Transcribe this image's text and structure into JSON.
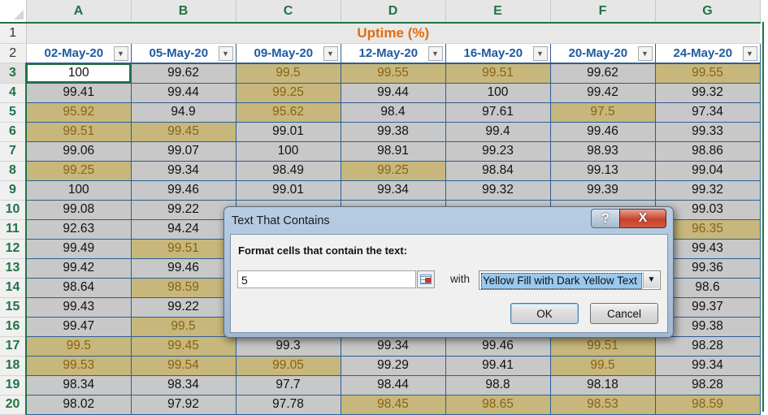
{
  "sheet": {
    "columns": [
      "A",
      "B",
      "C",
      "D",
      "E",
      "F",
      "G"
    ],
    "title_row": {
      "row": "1",
      "text": "Uptime (%)"
    },
    "header_row": {
      "row": "2",
      "dates": [
        "02-May-20",
        "05-May-20",
        "09-May-20",
        "12-May-20",
        "16-May-20",
        "20-May-20",
        "24-May-20"
      ],
      "filter_icon": "dropdown-arrow"
    },
    "rows": [
      {
        "num": "3",
        "values": [
          "100",
          "99.62",
          "99.5",
          "99.55",
          "99.51",
          "99.62",
          "99.55"
        ],
        "highlight": [
          false,
          false,
          true,
          true,
          true,
          false,
          true
        ]
      },
      {
        "num": "4",
        "values": [
          "99.41",
          "99.44",
          "99.25",
          "99.44",
          "100",
          "99.42",
          "99.32"
        ],
        "highlight": [
          false,
          false,
          true,
          false,
          false,
          false,
          false
        ]
      },
      {
        "num": "5",
        "values": [
          "95.92",
          "94.9",
          "95.62",
          "98.4",
          "97.61",
          "97.5",
          "97.34"
        ],
        "highlight": [
          true,
          false,
          true,
          false,
          false,
          true,
          false
        ]
      },
      {
        "num": "6",
        "values": [
          "99.51",
          "99.45",
          "99.01",
          "99.38",
          "99.4",
          "99.46",
          "99.33"
        ],
        "highlight": [
          true,
          true,
          false,
          false,
          false,
          false,
          false
        ]
      },
      {
        "num": "7",
        "values": [
          "99.06",
          "99.07",
          "100",
          "98.91",
          "99.23",
          "98.93",
          "98.86"
        ],
        "highlight": [
          false,
          false,
          false,
          false,
          false,
          false,
          false
        ]
      },
      {
        "num": "8",
        "values": [
          "99.25",
          "99.34",
          "98.49",
          "99.25",
          "98.84",
          "99.13",
          "99.04"
        ],
        "highlight": [
          true,
          false,
          false,
          true,
          false,
          false,
          false
        ]
      },
      {
        "num": "9",
        "values": [
          "100",
          "99.46",
          "99.01",
          "99.34",
          "99.32",
          "99.39",
          "99.32"
        ],
        "highlight": [
          false,
          false,
          false,
          false,
          false,
          false,
          false
        ]
      },
      {
        "num": "10",
        "values": [
          "99.08",
          "99.22",
          "",
          "",
          "",
          "",
          "99.03"
        ],
        "highlight": [
          false,
          false,
          false,
          false,
          false,
          false,
          false
        ]
      },
      {
        "num": "11",
        "values": [
          "92.63",
          "94.24",
          "",
          "",
          "",
          "",
          "96.35"
        ],
        "highlight": [
          false,
          false,
          false,
          true,
          false,
          false,
          true
        ]
      },
      {
        "num": "12",
        "values": [
          "99.49",
          "99.51",
          "",
          "",
          "",
          "",
          "99.43"
        ],
        "highlight": [
          false,
          true,
          false,
          false,
          false,
          false,
          false
        ]
      },
      {
        "num": "13",
        "values": [
          "99.42",
          "99.46",
          "",
          "",
          "",
          "",
          "99.36"
        ],
        "highlight": [
          false,
          false,
          false,
          false,
          false,
          false,
          false
        ]
      },
      {
        "num": "14",
        "values": [
          "98.64",
          "98.59",
          "",
          "",
          "",
          "",
          "98.6"
        ],
        "highlight": [
          false,
          true,
          false,
          false,
          false,
          false,
          false
        ]
      },
      {
        "num": "15",
        "values": [
          "99.43",
          "99.22",
          "",
          "",
          "",
          "",
          "99.37"
        ],
        "highlight": [
          false,
          false,
          false,
          false,
          false,
          false,
          false
        ]
      },
      {
        "num": "16",
        "values": [
          "99.47",
          "99.5",
          "",
          "",
          "",
          "",
          "99.38"
        ],
        "highlight": [
          false,
          true,
          false,
          false,
          false,
          false,
          false
        ]
      },
      {
        "num": "17",
        "values": [
          "99.5",
          "99.45",
          "99.3",
          "99.34",
          "99.46",
          "99.51",
          "98.28"
        ],
        "highlight": [
          true,
          true,
          false,
          false,
          false,
          true,
          false
        ]
      },
      {
        "num": "18",
        "values": [
          "99.53",
          "99.54",
          "99.05",
          "99.29",
          "99.41",
          "99.5",
          "99.34"
        ],
        "highlight": [
          true,
          true,
          true,
          false,
          false,
          true,
          false
        ]
      },
      {
        "num": "19",
        "values": [
          "98.34",
          "98.34",
          "97.7",
          "98.44",
          "98.8",
          "98.18",
          "98.28"
        ],
        "highlight": [
          false,
          false,
          false,
          false,
          false,
          false,
          false
        ]
      },
      {
        "num": "20",
        "values": [
          "98.02",
          "97.92",
          "97.78",
          "98.45",
          "98.65",
          "98.53",
          "98.59"
        ],
        "highlight": [
          false,
          false,
          false,
          true,
          true,
          true,
          true
        ]
      }
    ],
    "selected_cell": "A3",
    "colors": {
      "highlight_fill": "#c7b77c",
      "highlight_text": "#8a6214",
      "cell_fill": "#c8c8c8",
      "title_color": "#e36c0a",
      "header_color": "#1f5aa0",
      "excel_green": "#217346"
    }
  },
  "dialog": {
    "title": "Text That Contains",
    "help_label": "?",
    "close_label": "X",
    "prompt": "Format cells that contain the text:",
    "input_value": "5",
    "with_label": "with",
    "format_selected": "Yellow Fill with Dark Yellow Text",
    "ok_label": "OK",
    "cancel_label": "Cancel"
  }
}
